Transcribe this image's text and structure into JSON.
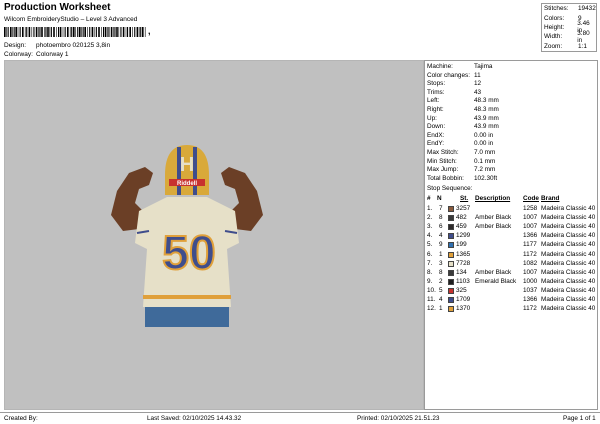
{
  "header": {
    "title": "Production Worksheet",
    "subtitle": "Wilcom EmbroideryStudio – Level 3 Advanced",
    "barcode_text": ",",
    "design_label": "Design:",
    "design_value": "photoembro 020125 3,8in",
    "colorway_label": "Colorway:",
    "colorway_value": "Colorway 1"
  },
  "stats": [
    {
      "label": "Stitches:",
      "value": "19432"
    },
    {
      "label": "Colors:",
      "value": "9"
    },
    {
      "label": "Height:",
      "value": "3.46 in"
    },
    {
      "label": "Width:",
      "value": "3.80 in"
    },
    {
      "label": "Zoom:",
      "value": "1:1"
    }
  ],
  "design": {
    "jersey_number": "50",
    "helmet_letter": "H",
    "helmet_text": "Riddell"
  },
  "machine_info": [
    {
      "label": "Machine:",
      "value": "Tajima"
    },
    {
      "label": "Color changes:",
      "value": "11"
    },
    {
      "label": "Stops:",
      "value": "12"
    },
    {
      "label": "Trims:",
      "value": "43"
    },
    {
      "label": "Left:",
      "value": "48.3 mm"
    },
    {
      "label": "Right:",
      "value": "48.3 mm"
    },
    {
      "label": "Up:",
      "value": "43.9 mm"
    },
    {
      "label": "Down:",
      "value": "43.9 mm"
    },
    {
      "label": "EndX:",
      "value": "0.00 in"
    },
    {
      "label": "EndY:",
      "value": "0.00 in"
    },
    {
      "label": "Max Stitch:",
      "value": "7.0 mm"
    },
    {
      "label": "Min Stitch:",
      "value": "0.1 mm"
    },
    {
      "label": "Max Jump:",
      "value": "7.2 mm"
    },
    {
      "label": "Total Bobbin:",
      "value": "102.30ft"
    }
  ],
  "stop_sequence": {
    "label": "Stop Sequence:",
    "headers": {
      "num": "#",
      "n": "N",
      "st": "St.",
      "description": "Description",
      "code": "Code",
      "brand": "Brand"
    },
    "rows": [
      {
        "num": "1.",
        "n": "7",
        "color": "#8a5a3c",
        "st": "3257",
        "description": "",
        "code": "1258",
        "brand": "Madeira Classic 40"
      },
      {
        "num": "2.",
        "n": "8",
        "color": "#3a3a3a",
        "st": "482",
        "description": "Amber Black",
        "code": "1007",
        "brand": "Madeira Classic 40"
      },
      {
        "num": "3.",
        "n": "6",
        "color": "#2e2a2a",
        "st": "459",
        "description": "Amber Black",
        "code": "1007",
        "brand": "Madeira Classic 40"
      },
      {
        "num": "4.",
        "n": "4",
        "color": "#3f4d8c",
        "st": "1299",
        "description": "",
        "code": "1366",
        "brand": "Madeira Classic 40"
      },
      {
        "num": "5.",
        "n": "9",
        "color": "#2f6fb0",
        "st": "199",
        "description": "",
        "code": "1177",
        "brand": "Madeira Classic 40"
      },
      {
        "num": "6.",
        "n": "1",
        "color": "#e0a03a",
        "st": "1365",
        "description": "",
        "code": "1172",
        "brand": "Madeira Classic 40"
      },
      {
        "num": "7.",
        "n": "3",
        "color": "#e6e0c8",
        "st": "7728",
        "description": "",
        "code": "1082",
        "brand": "Madeira Classic 40"
      },
      {
        "num": "8.",
        "n": "8",
        "color": "#3a3a3a",
        "st": "134",
        "description": "Amber Black",
        "code": "1007",
        "brand": "Madeira Classic 40"
      },
      {
        "num": "9.",
        "n": "2",
        "color": "#1e1e1e",
        "st": "1103",
        "description": "Emerald Black",
        "code": "1000",
        "brand": "Madeira Classic 40"
      },
      {
        "num": "10.",
        "n": "5",
        "color": "#c8322e",
        "st": "325",
        "description": "",
        "code": "1037",
        "brand": "Madeira Classic 40"
      },
      {
        "num": "11.",
        "n": "4",
        "color": "#3f4d8c",
        "st": "1709",
        "description": "",
        "code": "1366",
        "brand": "Madeira Classic 40"
      },
      {
        "num": "12.",
        "n": "1",
        "color": "#e0a03a",
        "st": "1370",
        "description": "",
        "code": "1172",
        "brand": "Madeira Classic 40"
      }
    ]
  },
  "footer": {
    "created_by": "Created By:",
    "last_saved": "Last Saved: 02/10/2025 14.43.32",
    "printed": "Printed: 02/10/2025 21.51.23",
    "page": "Page 1 of 1"
  },
  "colors": {
    "canvas_bg": "#c0c0c0",
    "jersey": "#e6e0c8",
    "number_fill": "#3f4d8c",
    "number_outline": "#e0a03a",
    "skin": "#6b3f26",
    "helmet_gold": "#d9a93a",
    "pants": "#3f6a9a"
  }
}
